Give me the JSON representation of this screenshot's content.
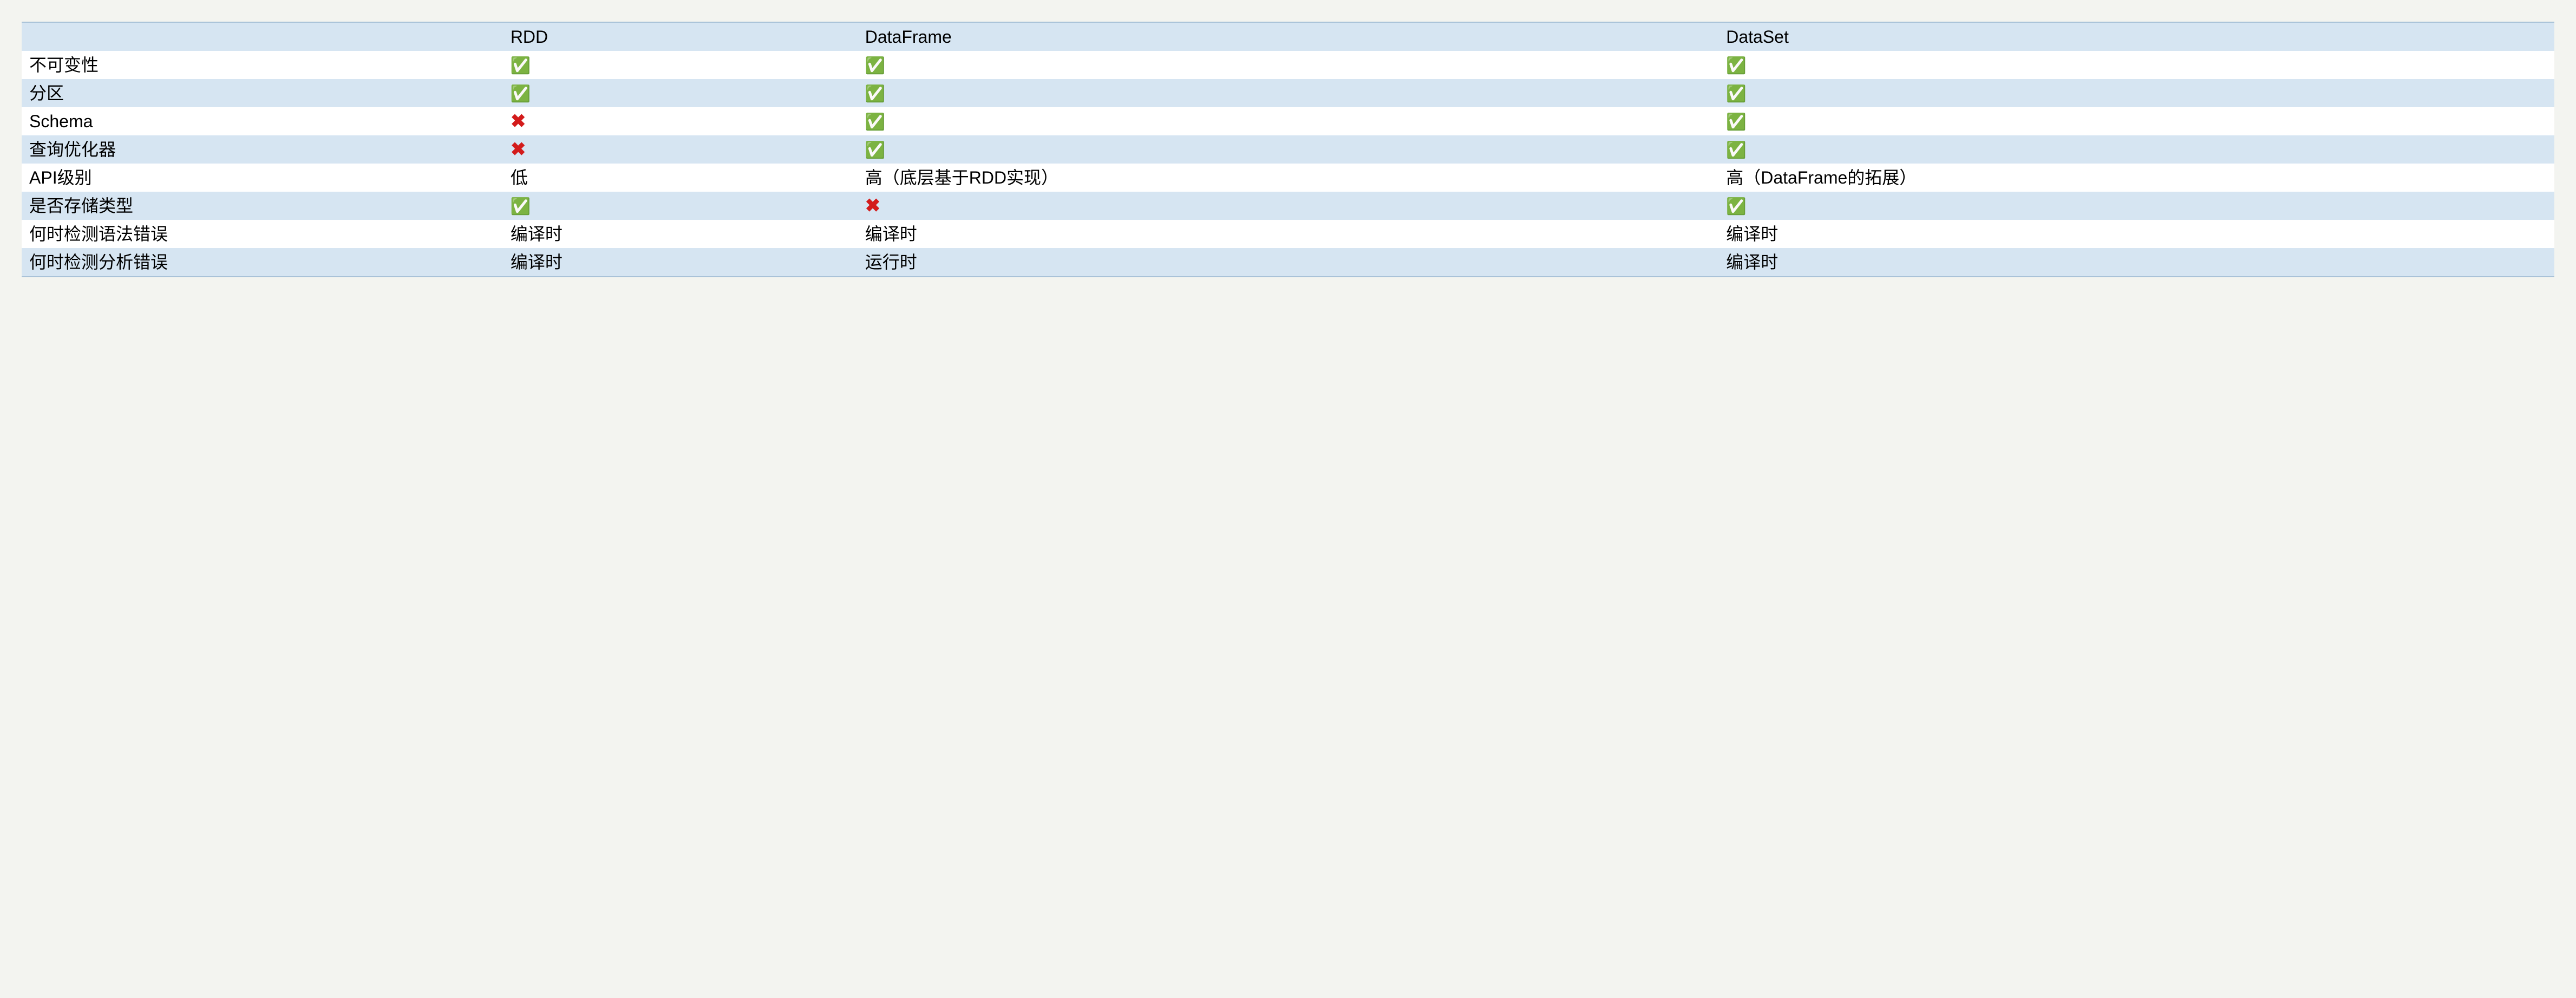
{
  "icons": {
    "check": "✅",
    "cross": "✖"
  },
  "table": {
    "headers": [
      "",
      "RDD",
      "DataFrame",
      "DataSet"
    ],
    "rows": [
      {
        "label": "不可变性",
        "cells": [
          {
            "icon": "check"
          },
          {
            "icon": "check"
          },
          {
            "icon": "check"
          }
        ]
      },
      {
        "label": "分区",
        "cells": [
          {
            "icon": "check"
          },
          {
            "icon": "check"
          },
          {
            "icon": "check"
          }
        ]
      },
      {
        "label": "Schema",
        "cells": [
          {
            "icon": "cross"
          },
          {
            "icon": "check"
          },
          {
            "icon": "check"
          }
        ]
      },
      {
        "label": "查询优化器",
        "cells": [
          {
            "icon": "cross"
          },
          {
            "icon": "check"
          },
          {
            "icon": "check"
          }
        ]
      },
      {
        "label": "API级别",
        "cells": [
          {
            "text": "低"
          },
          {
            "text": "高（底层基于RDD实现）"
          },
          {
            "text": "高（DataFrame的拓展）"
          }
        ]
      },
      {
        "label": "是否存储类型",
        "cells": [
          {
            "icon": "check"
          },
          {
            "icon": "cross"
          },
          {
            "icon": "check"
          }
        ]
      },
      {
        "label": "何时检测语法错误",
        "cells": [
          {
            "text": "编译时"
          },
          {
            "text": "编译时"
          },
          {
            "text": "编译时"
          }
        ]
      },
      {
        "label": "何时检测分析错误",
        "cells": [
          {
            "text": "编译时"
          },
          {
            "text": "运行时"
          },
          {
            "text": "编译时"
          }
        ]
      }
    ]
  }
}
